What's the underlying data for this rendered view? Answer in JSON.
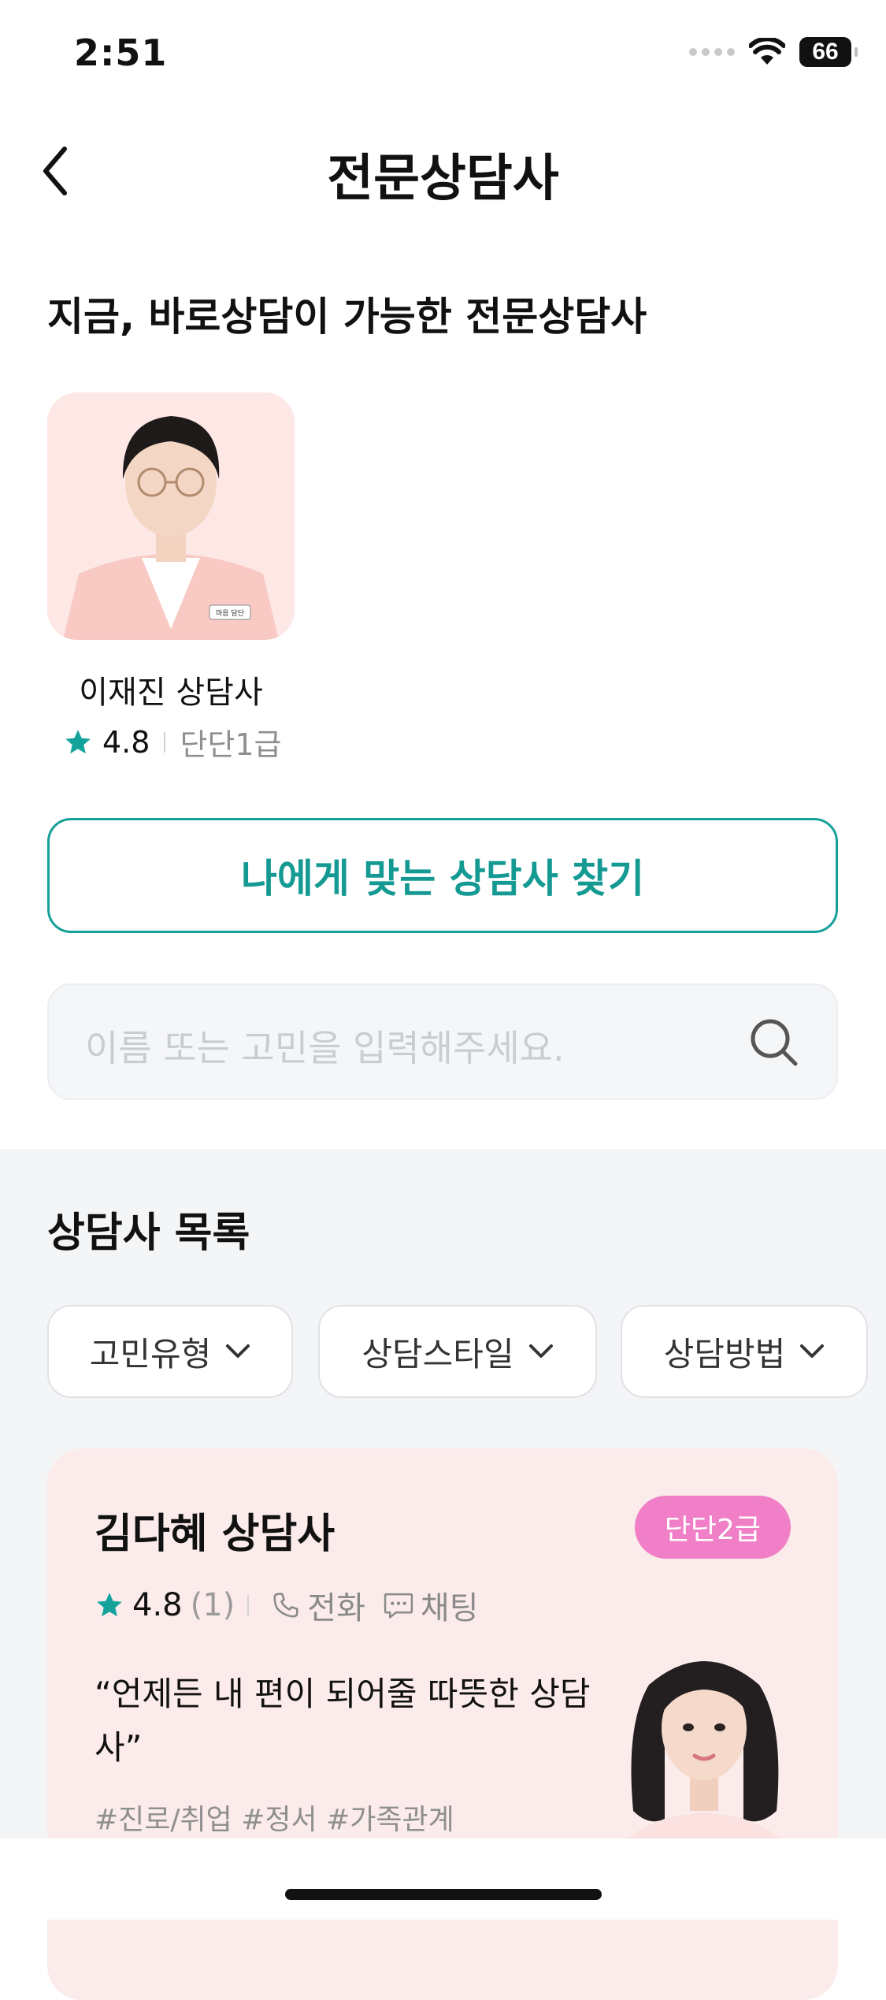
{
  "status_bar": {
    "time": "2:51",
    "battery": "66"
  },
  "header": {
    "title": "전문상담사"
  },
  "available": {
    "heading": "지금, 바로상담이 가능한 전문상담사",
    "counselor": {
      "name": "이재진 상담사",
      "rating": "4.8",
      "grade": "단단1급",
      "badge_text": "마음 담단"
    }
  },
  "find_button": {
    "label": "나에게 맞는 상담사 찾기"
  },
  "search": {
    "placeholder": "이름 또는 고민을 입력해주세요."
  },
  "list": {
    "heading": "상담사 목록",
    "filters": [
      "고민유형",
      "상담스타일",
      "상담방법"
    ],
    "card": {
      "name": "김다혜 상담사",
      "grade": "단단2급",
      "rating": "4.8",
      "count": "(1)",
      "methods": [
        "전화",
        "채팅"
      ],
      "quote": "“언제든 내 편이 되어줄 따뜻한 상담사”",
      "tags": "#진로/취업 #정서 #가족관계"
    }
  },
  "colors": {
    "accent": "#15a09a",
    "badge": "#f07fc8",
    "card_bg": "#fbeceb",
    "section_bg": "#f4f5f7"
  }
}
